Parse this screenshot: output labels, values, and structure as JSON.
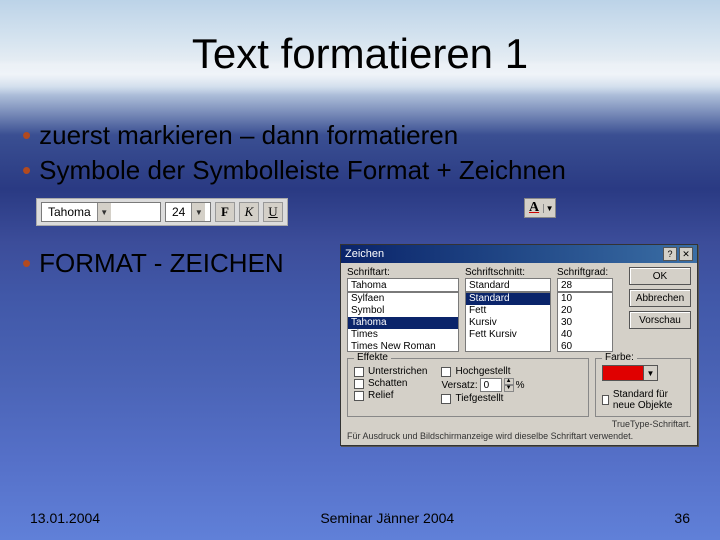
{
  "title": "Text formatieren 1",
  "bullets": [
    "zuerst markieren – dann formatieren",
    "Symbole der Symbolleiste Format + Zeichnen",
    "FORMAT - ZEICHEN"
  ],
  "toolbar": {
    "font": "Tahoma",
    "size": "24",
    "bold": "F",
    "italic": "K",
    "underline": "U",
    "fontcolor_glyph": "A"
  },
  "dialog": {
    "title": "Zeichen",
    "labels": {
      "font": "Schriftart:",
      "style": "Schriftschnitt:",
      "size": "Schriftgrad:",
      "effects": "Effekte",
      "color": "Farbe:"
    },
    "font_value": "Tahoma",
    "style_value": "Standard",
    "size_value": "28",
    "font_list": [
      "Sylfaen",
      "Symbol",
      "Tahoma",
      "Times",
      "Times New Roman"
    ],
    "font_selected_index": 2,
    "style_list": [
      "Standard",
      "Fett",
      "Kursiv",
      "Fett Kursiv"
    ],
    "style_selected_index": 0,
    "size_list": [
      "10",
      "20",
      "30",
      "40",
      "60"
    ],
    "effects": {
      "underline": "Unterstrichen",
      "superscript": "Hochgestellt",
      "shadow": "Schatten",
      "subscript": "Tiefgestellt",
      "relief": "Relief"
    },
    "offset_label": "Versatz:",
    "offset_value": "0",
    "offset_unit": "%",
    "default_new": "Standard für neue Objekte",
    "buttons": {
      "ok": "OK",
      "cancel": "Abbrechen",
      "preview": "Vorschau"
    },
    "hint": "TrueType-Schriftart.",
    "hint2": "Für Ausdruck und Bildschirmanzeige wird dieselbe Schriftart verwendet."
  },
  "footer": {
    "date": "13.01.2004",
    "center": "Seminar Jänner 2004",
    "page": "36"
  }
}
